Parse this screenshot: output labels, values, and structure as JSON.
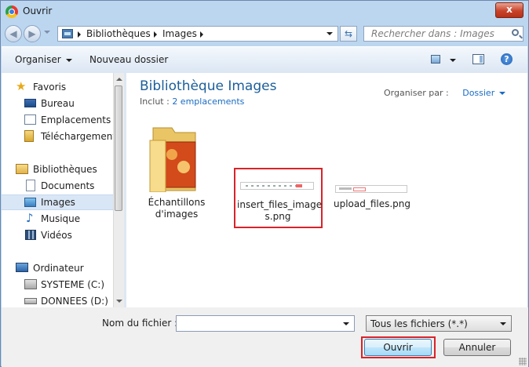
{
  "window": {
    "title": "Ouvrir",
    "close_glyph": "x"
  },
  "address": {
    "crumbs": [
      "Bibliothèques",
      "Images"
    ],
    "search_placeholder": "Rechercher dans : Images"
  },
  "toolbar": {
    "organize": "Organiser",
    "new_folder": "Nouveau dossier",
    "help_glyph": "?"
  },
  "nav": {
    "items": [
      {
        "label": "Favoris",
        "icon": "star-icon"
      },
      {
        "label": "Bureau",
        "icon": "desktop-icon"
      },
      {
        "label": "Emplacements ré",
        "icon": "recent-places-icon"
      },
      {
        "label": "Téléchargements",
        "icon": "downloads-icon"
      },
      {
        "label": "Bibliothèques",
        "icon": "libraries-icon"
      },
      {
        "label": "Documents",
        "icon": "documents-icon"
      },
      {
        "label": "Images",
        "icon": "pictures-icon",
        "selected": true
      },
      {
        "label": "Musique",
        "icon": "music-icon"
      },
      {
        "label": "Vidéos",
        "icon": "videos-icon"
      },
      {
        "label": "Ordinateur",
        "icon": "computer-icon"
      },
      {
        "label": "SYSTEME (C:)",
        "icon": "drive-c-icon"
      },
      {
        "label": "DONNEES (D:)",
        "icon": "drive-d-icon"
      }
    ]
  },
  "library": {
    "title": "Bibliothèque Images",
    "include_label": "Inclut :",
    "include_link": "2 emplacements",
    "arrange_label": "Organiser par :",
    "arrange_value": "Dossier"
  },
  "files": [
    {
      "label_line1": "Échantillons",
      "label_line2": "d'images",
      "icon": "sample-pictures-folder-icon"
    },
    {
      "label_line1": "insert_files_image",
      "label_line2": "s.png",
      "icon": "image-thumbnail-icon",
      "highlighted": true
    },
    {
      "label_line1": "upload_files.png",
      "label_line2": "",
      "icon": "image-thumbnail-icon"
    }
  ],
  "footer": {
    "filename_label": "Nom du fichier :",
    "filename_value": "",
    "filetype_value": "Tous les fichiers (*.*)",
    "open_label": "Ouvrir",
    "cancel_label": "Annuler"
  },
  "colors": {
    "accent_title": "#1b5e9b",
    "link": "#1a6bc4",
    "highlight_red": "#d8232a"
  }
}
